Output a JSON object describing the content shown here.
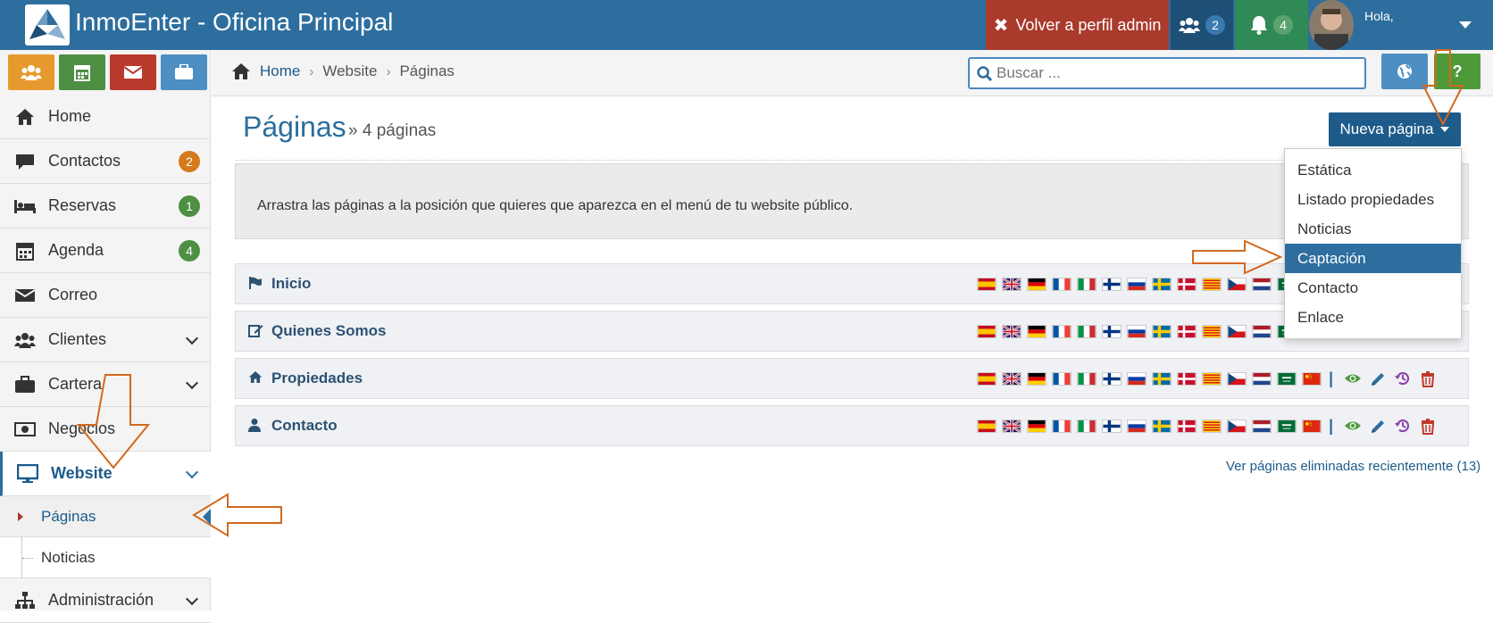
{
  "header": {
    "app_title": "InmoEnter - Oficina Principal",
    "admin_button": "Volver a perfil admin",
    "users_count": "2",
    "notifications_count": "4",
    "greeting": "Hola,"
  },
  "quick_actions": [
    {
      "icon": "users-icon",
      "color": "#e69a2e"
    },
    {
      "icon": "calendar-icon",
      "color": "#4e8f44"
    },
    {
      "icon": "envelope-icon",
      "color": "#b93a2d"
    },
    {
      "icon": "briefcase-icon",
      "color": "#4d8fc2"
    }
  ],
  "sidebar": {
    "items": [
      {
        "label": "Home",
        "icon": "home-icon"
      },
      {
        "label": "Contactos",
        "icon": "comment-icon",
        "badge": "2",
        "badge_color": "#d47a1b"
      },
      {
        "label": "Reservas",
        "icon": "bed-icon",
        "badge": "1",
        "badge_color": "#4e8f44"
      },
      {
        "label": "Agenda",
        "icon": "calendar-icon",
        "badge": "4",
        "badge_color": "#4e8f44"
      },
      {
        "label": "Correo",
        "icon": "envelope-icon"
      },
      {
        "label": "Clientes",
        "icon": "users-icon"
      },
      {
        "label": "Cartera",
        "icon": "briefcase-icon"
      },
      {
        "label": "Negocios",
        "icon": "money-icon"
      },
      {
        "label": "Website",
        "icon": "desktop-icon"
      },
      {
        "label": "Administración",
        "icon": "sitemap-icon"
      }
    ],
    "website_sub": [
      {
        "label": "Páginas"
      },
      {
        "label": "Noticias"
      }
    ]
  },
  "breadcrumb": {
    "home": "Home",
    "section": "Website",
    "current": "Páginas"
  },
  "search": {
    "placeholder": "Buscar ..."
  },
  "help_label": "?",
  "page": {
    "title": "Páginas",
    "subtitle": "» 4 páginas",
    "new_button": "Nueva página",
    "info": "Arrastra las páginas a la posición que quieres que aparezca en el menú de tu website público.",
    "deleted_link": "Ver páginas eliminadas recientemente (13)"
  },
  "dropdown": {
    "items": [
      "Estática",
      "Listado propiedades",
      "Noticias",
      "Captación",
      "Contacto",
      "Enlace"
    ],
    "highlighted": "Captación"
  },
  "pages": [
    {
      "name": "Inicio",
      "icon": "flag-icon"
    },
    {
      "name": "Quienes Somos",
      "icon": "edit-icon"
    },
    {
      "name": "Propiedades",
      "icon": "home-icon"
    },
    {
      "name": "Contacto",
      "icon": "user-icon"
    }
  ],
  "flags": [
    "es",
    "gb",
    "de",
    "fr",
    "it",
    "fi",
    "ru",
    "se",
    "dk",
    "cat",
    "cz",
    "nl",
    "sa",
    "cn"
  ],
  "colors": {
    "header": "#2d6e9e",
    "accent": "#1e5b8a",
    "admin_red": "#a93a2c",
    "annotation_arrow": "#d2691e"
  }
}
